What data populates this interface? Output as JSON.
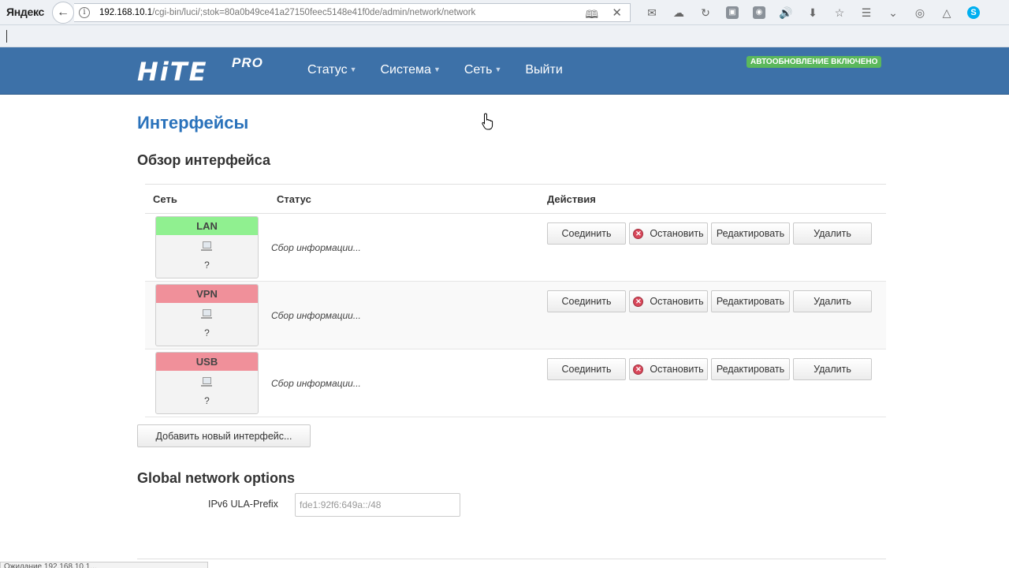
{
  "browser": {
    "brand": "Яндекс",
    "address": {
      "host": "192.168.10.1",
      "path": "/cgi-bin/luci/;stok=80a0b49ce41a27150feec5148e41f0de/admin/network/network"
    },
    "statusbar_text": "Ожидание 192.168.10.1..."
  },
  "header": {
    "logo_main": "HiTE",
    "logo_sub": "PRO",
    "nav": [
      {
        "label": "Статус"
      },
      {
        "label": "Система"
      },
      {
        "label": "Сеть"
      },
      {
        "label": "Выйти"
      }
    ],
    "badge": "АВТООБНОВЛЕНИЕ ВКЛЮЧЕНО"
  },
  "page": {
    "title": "Интерфейсы",
    "section": "Обзор интерфейса",
    "columns": {
      "network": "Сеть",
      "status": "Статус",
      "actions": "Действия"
    },
    "interfaces": [
      {
        "name": "LAN",
        "device": "?",
        "status": "Сбор информации...",
        "color": "#90f090"
      },
      {
        "name": "VPN",
        "device": "?",
        "status": "Сбор информации...",
        "color": "#f0909a"
      },
      {
        "name": "USB",
        "device": "?",
        "status": "Сбор информации...",
        "color": "#f0909a"
      }
    ],
    "actions": {
      "connect": "Соединить",
      "stop": "Остановить",
      "edit": "Редактировать",
      "delete": "Удалить"
    },
    "add_button": "Добавить новый интерфейс...",
    "global_title": "Global network options",
    "ula_label": "IPv6 ULA-Prefix",
    "ula_value": "fde1:92f6:649a::/48"
  }
}
